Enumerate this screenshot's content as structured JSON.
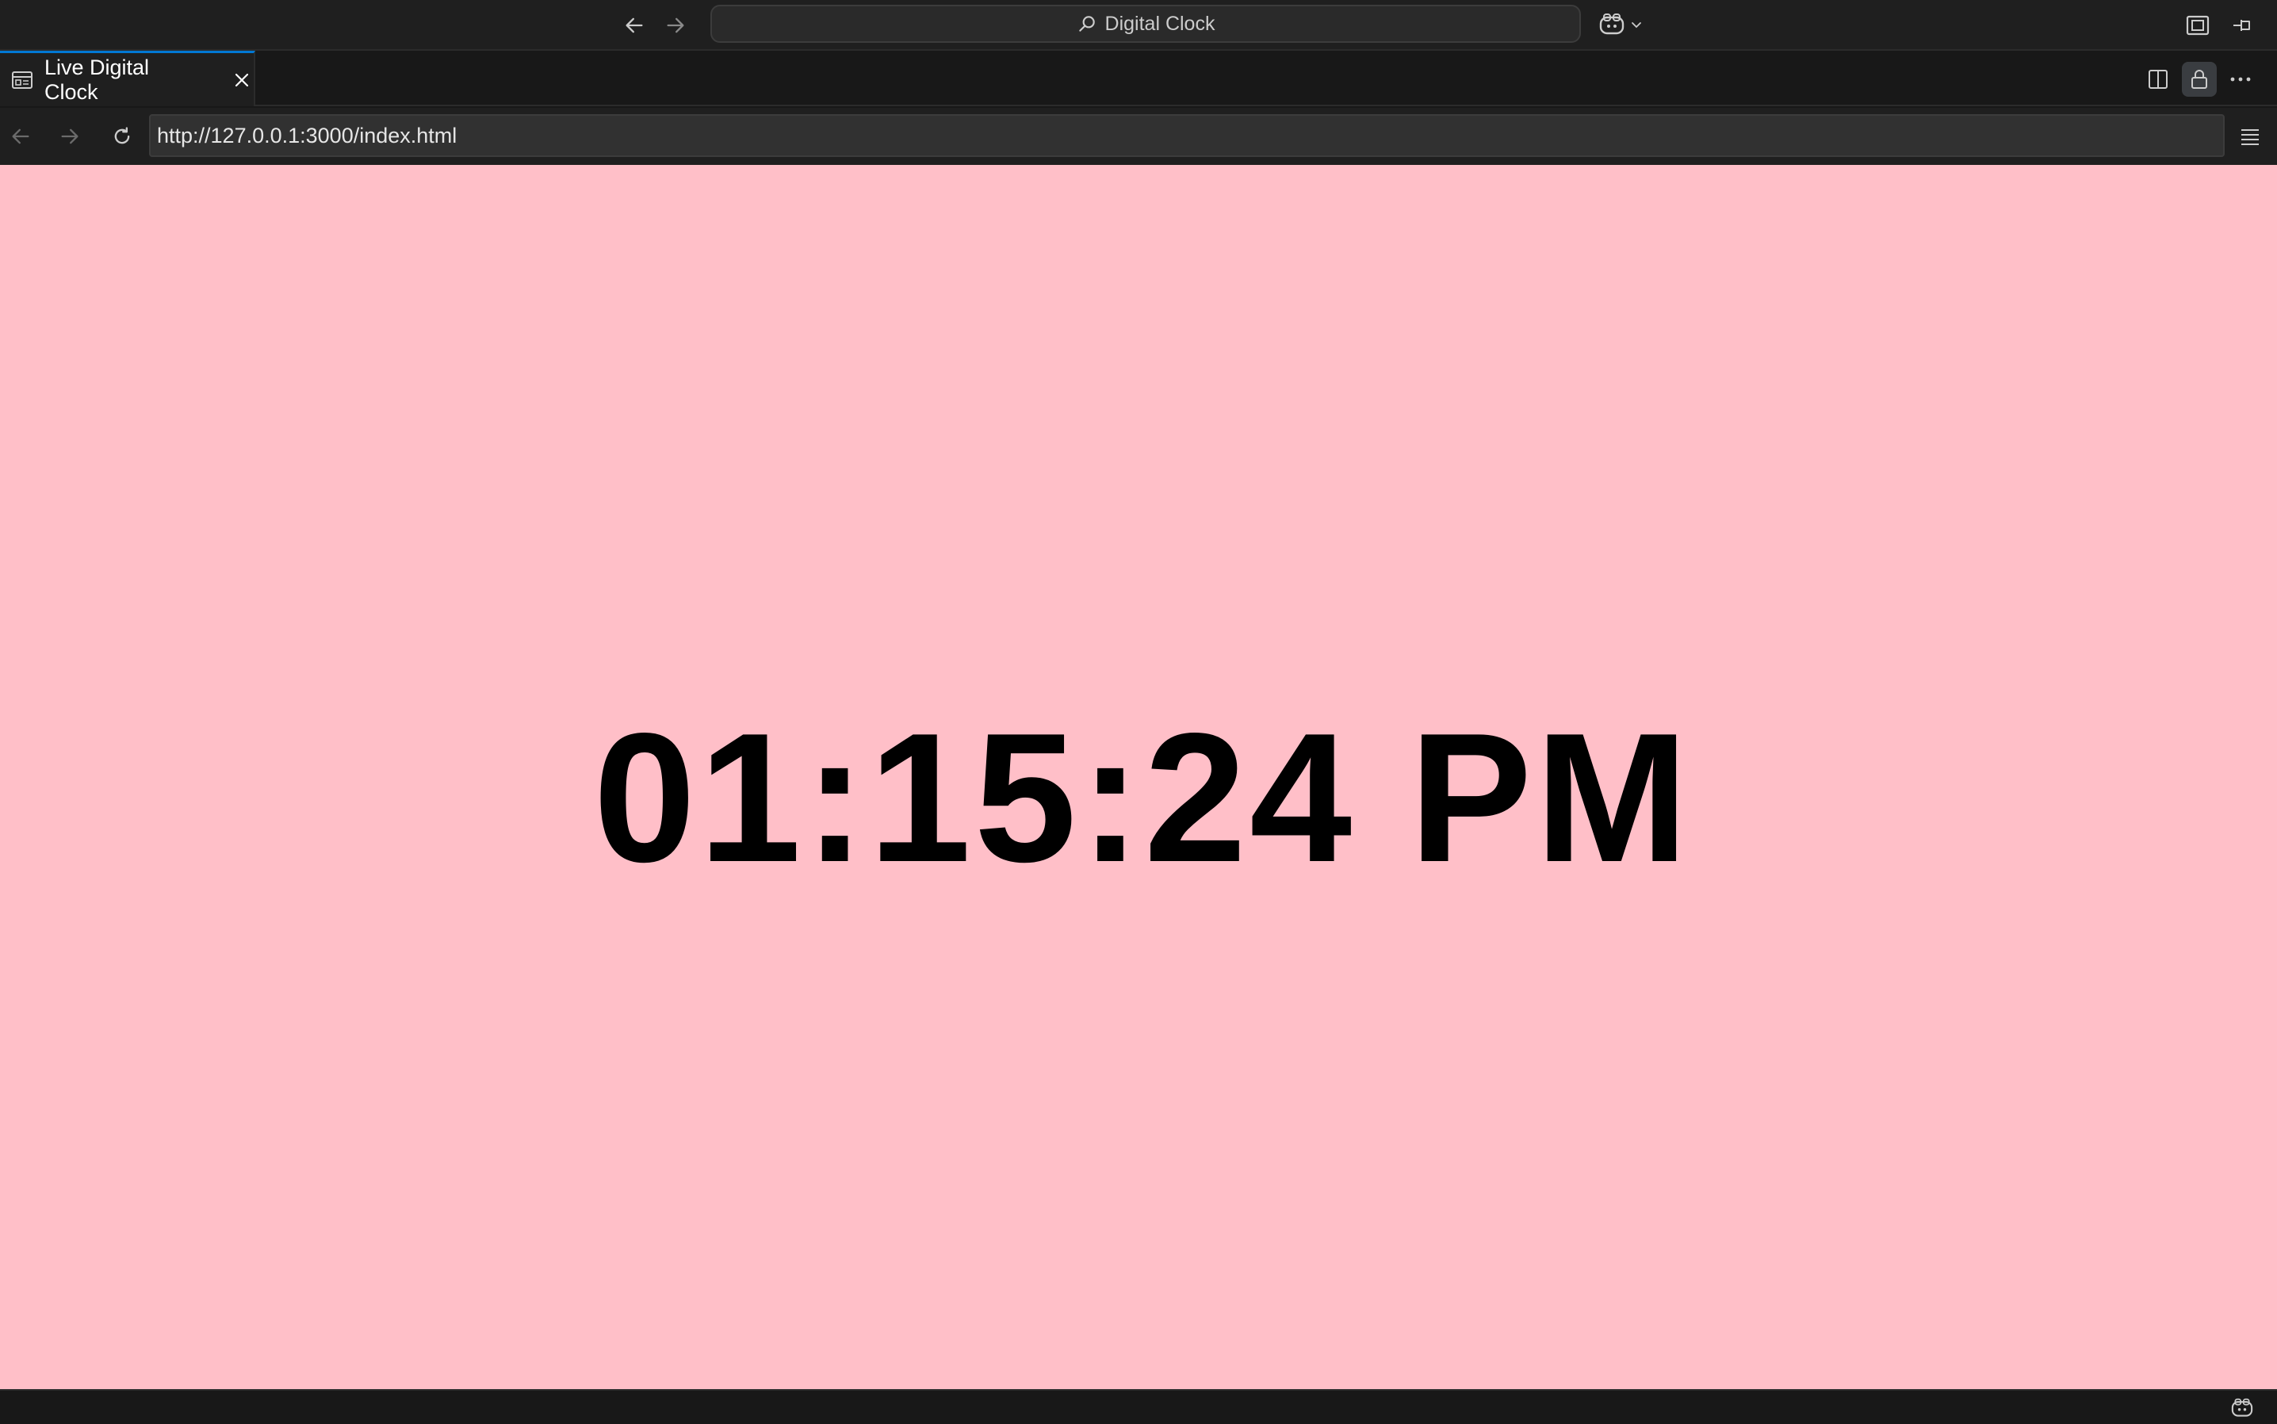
{
  "titlebar": {
    "command_center_text": "Digital Clock"
  },
  "tab": {
    "label": "Live Digital Clock"
  },
  "urlbar": {
    "url": "http://127.0.0.1:3000/index.html"
  },
  "page": {
    "clock_time": "01:15:24 PM",
    "background_color": "#ffbfc8",
    "text_color": "#000000"
  },
  "colors": {
    "accent": "#0078d4",
    "chrome_bg": "#1f1f1f"
  }
}
